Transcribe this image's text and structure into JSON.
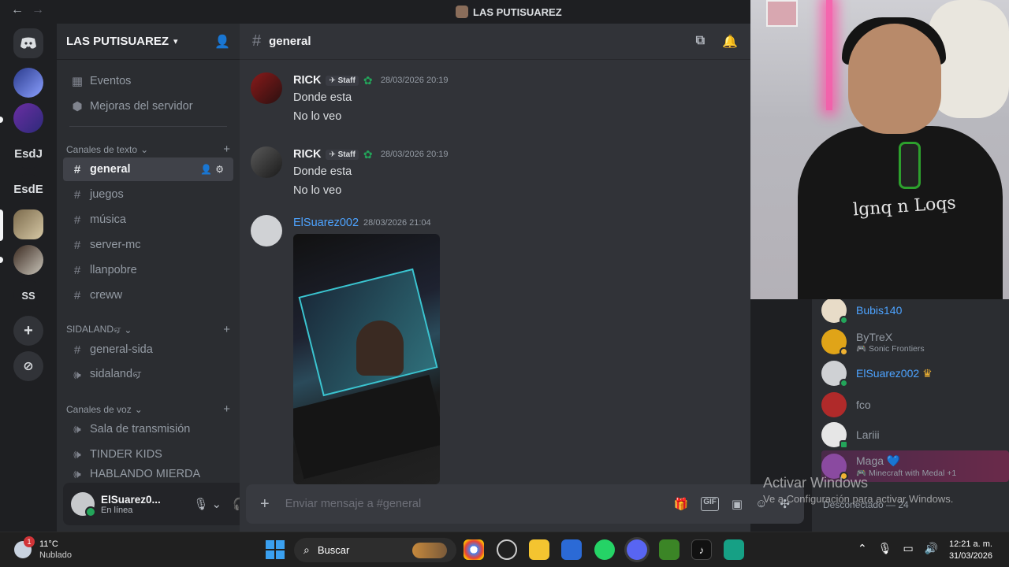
{
  "window": {
    "title": "LAS PUTISUAREZ",
    "back": "←",
    "forward": "→"
  },
  "guilds": {
    "items": [
      {
        "label": "EsdJ"
      },
      {
        "label": "EsdE"
      },
      {
        "label": "SS"
      }
    ],
    "add": "+",
    "discover": "⊘"
  },
  "server": {
    "name": "LAS PUTISUAREZ",
    "top_items": [
      "Eventos",
      "Mejoras del servidor"
    ],
    "categories": {
      "text": "Canales de texto",
      "sidaland": "SIDALANDஏ",
      "voice": "Canales de voz"
    },
    "text_channels": [
      "general",
      "juegos",
      "música",
      "server-mc",
      "llanpobre",
      "creww"
    ],
    "sidaland_channels": [
      "general-sida",
      "sidalandஏ"
    ],
    "voice_channels": [
      "Sala de transmisión",
      "TINDER KIDS",
      "HABLANDO MIERDA"
    ]
  },
  "user": {
    "name": "ElSuarez0...",
    "status": "En línea"
  },
  "chat": {
    "channel": "general",
    "messages": [
      {
        "author": "RICK",
        "badge": "Staff",
        "time": "28/03/2026 20:19",
        "lines": [
          "Donde esta",
          "No lo veo"
        ]
      },
      {
        "author": "RICK",
        "badge": "Staff",
        "time": "28/03/2026 20:19",
        "lines": [
          "Donde esta",
          "No lo veo"
        ]
      },
      {
        "author": "ElSuarez002",
        "time": "28/03/2026 21:04"
      }
    ],
    "composer_placeholder": "Enviar mensaje a #general"
  },
  "members": {
    "list": [
      {
        "name": "Bubis140",
        "activity": ""
      },
      {
        "name": "ByTreX",
        "activity": "Sonic Frontiers"
      },
      {
        "name": "ElSuarez002",
        "activity": ""
      },
      {
        "name": "fco",
        "activity": ""
      },
      {
        "name": "Lariii",
        "activity": ""
      },
      {
        "name": "Maga",
        "activity": "Minecraft with Medal +1"
      }
    ],
    "offline_header": "Desconectado — 24"
  },
  "overlay": {
    "activate_title": "Activar Windows",
    "activate_sub": "Ve a Configuración para activar Windows."
  },
  "webcam": {
    "shirt_text": "lgnq n Loqs"
  },
  "taskbar": {
    "weather_temp": "11°C",
    "weather_desc": "Nublado",
    "weather_badge": "1",
    "search": "Buscar",
    "time": "12:21 a. m.",
    "date": "31/03/2026"
  },
  "colors": {
    "accent": "#5865f2",
    "online": "#23a55a",
    "link": "#4da3ff"
  }
}
